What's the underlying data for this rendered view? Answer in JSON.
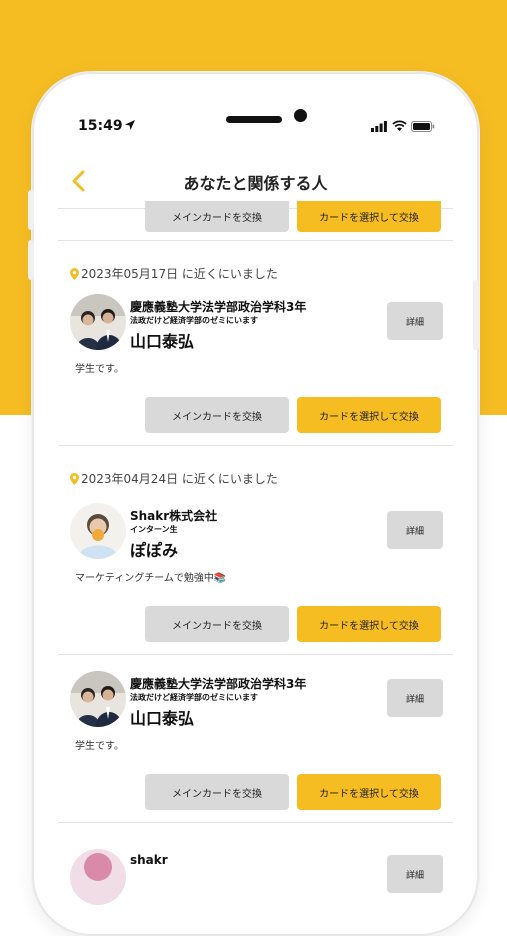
{
  "status_bar": {
    "time": "15:49"
  },
  "header": {
    "title": "あなたと関係する人"
  },
  "actions": {
    "main_card_exchange": "メインカードを交換",
    "select_card_exchange": "カードを選択して交換",
    "detail": "詳細"
  },
  "entries": [
    {
      "near": "2023年05月17日 に近くにいました",
      "org": "慶應義塾大学法学部政治学科3年",
      "role": "法政だけど経済学部のゼミにいます",
      "name": "山口泰弘",
      "bio": "学生です。"
    },
    {
      "near": "2023年04月24日 に近くにいました",
      "org": "Shakr株式会社",
      "role": "インターン生",
      "name": "ぽぽみ",
      "bio": "マーケティングチームで勉強中📚"
    },
    {
      "org": "慶應義塾大学法学部政治学科3年",
      "role": "法政だけど経済学部のゼミにいます",
      "name": "山口泰弘",
      "bio": "学生です。"
    },
    {
      "org": "shakr"
    }
  ],
  "colors": {
    "accent": "#f6bd23",
    "button_gray": "#d9d9d9"
  }
}
